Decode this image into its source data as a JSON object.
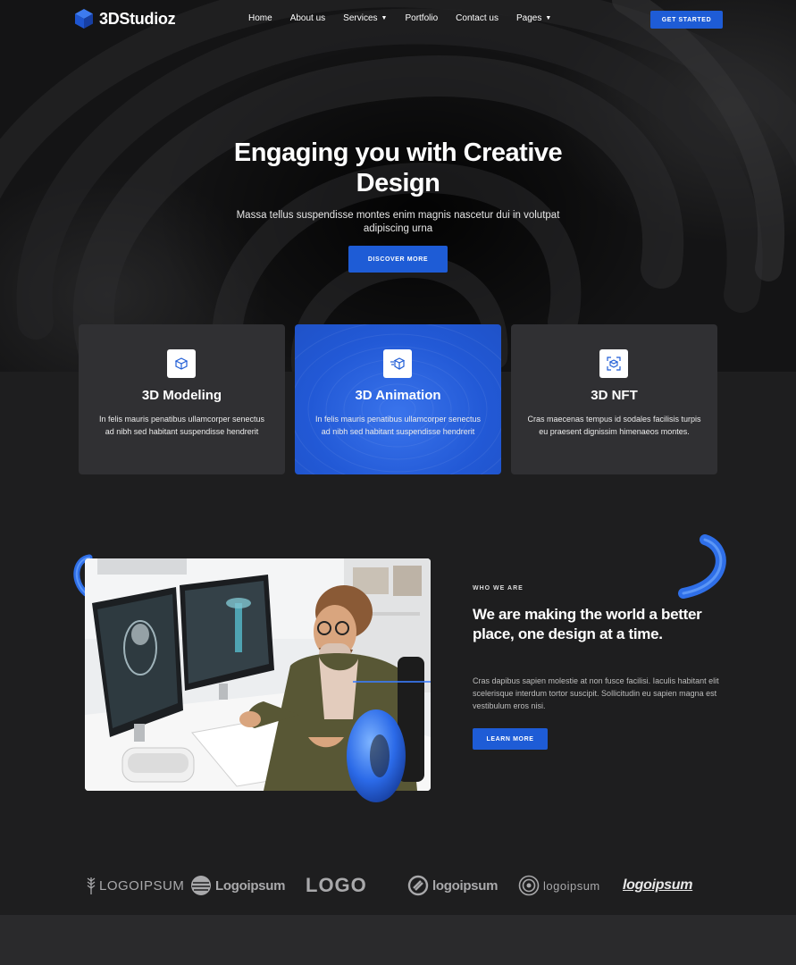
{
  "nav": {
    "brand": "3DStudioz",
    "items": [
      {
        "label": "Home"
      },
      {
        "label": "About us"
      },
      {
        "label": "Services",
        "has_dropdown": true
      },
      {
        "label": "Portfolio"
      },
      {
        "label": "Contact us"
      },
      {
        "label": "Pages",
        "has_dropdown": true
      }
    ],
    "cta": "GET STARTED"
  },
  "hero": {
    "title": "Engaging you with Creative Design",
    "subtitle": "Massa tellus suspendisse montes enim magnis nascetur dui in volutpat adipiscing urna",
    "cta": "DISCOVER MORE"
  },
  "services": [
    {
      "title": "3D Modeling",
      "description": "In felis mauris penatibus ullamcorper senectus ad nibh sed habitant suspendisse hendrerit",
      "icon": "cube-icon",
      "active": false
    },
    {
      "title": "3D Animation",
      "description": "In felis mauris penatibus ullamcorper senectus ad nibh sed habitant suspendisse hendrerit",
      "icon": "moving-cube-icon",
      "active": true
    },
    {
      "title": "3D NFT",
      "description": "Cras maecenas tempus id sodales facilisis turpis eu praesent dignissim himenaeos montes.",
      "icon": "scan-cube-icon",
      "active": false
    }
  ],
  "about": {
    "kicker": "WHO WE ARE",
    "title": "We are making the world a better place, one design at a time.",
    "text": "Cras dapibus sapien molestie at non fusce facilisi. Iaculis habitant elit scelerisque interdum tortor suscipit. Sollicitudin eu sapien magna est vestibulum eros nisi.",
    "cta": "LEARN MORE"
  },
  "logos": [
    "LOGOIPSUM",
    "Logoipsum",
    "LOGO",
    "logoipsum",
    "logoipsum",
    "logoipsum"
  ],
  "colors": {
    "accent": "#1e5cd6",
    "background": "#1e1e1f",
    "card": "#303033"
  }
}
